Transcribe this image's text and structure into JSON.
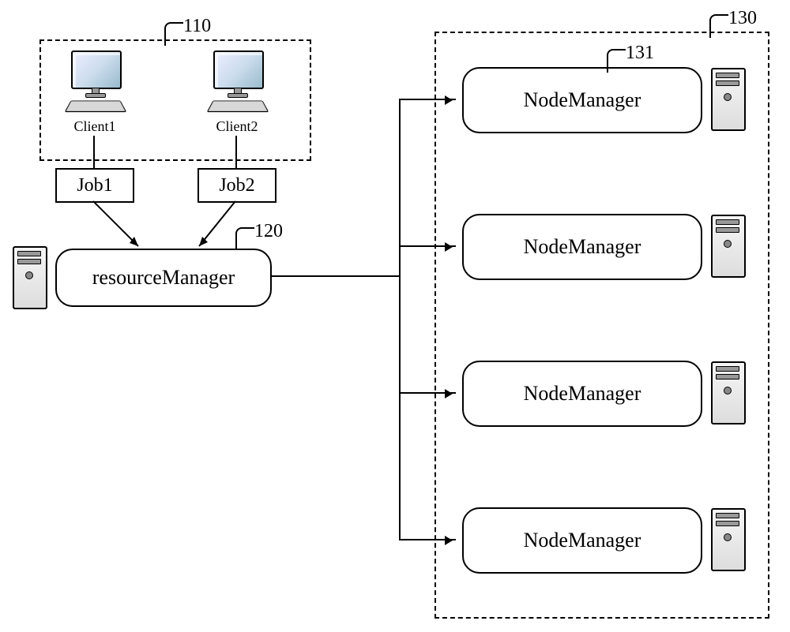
{
  "refs": {
    "clients": "110",
    "resourceManager": "120",
    "nodeGroup": "130",
    "nodeFirst": "131"
  },
  "clients": {
    "c1": "Client1",
    "c2": "Client2"
  },
  "jobs": {
    "j1": "Job1",
    "j2": "Job2"
  },
  "resourceManager": "resourceManager",
  "nodes": {
    "label": "NodeManager"
  }
}
